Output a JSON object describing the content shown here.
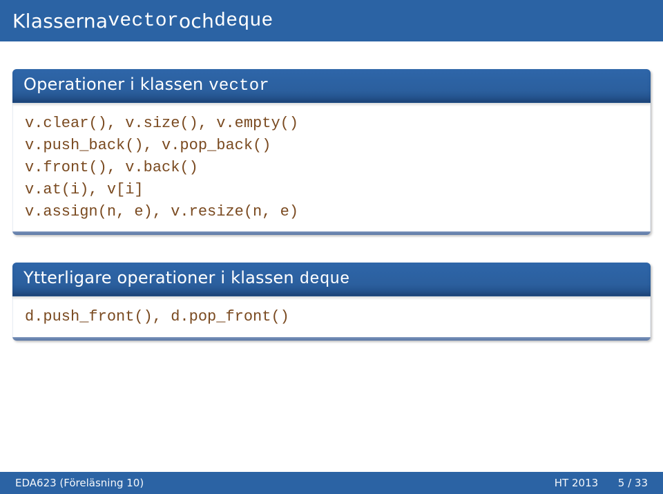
{
  "title": {
    "prefix": "Klasserna ",
    "code1": "vector",
    "mid": " och ",
    "code2": "deque"
  },
  "block1": {
    "header_prefix": "Operationer i klassen ",
    "header_code": "vector",
    "lines": [
      "v.clear(), v.size(), v.empty()",
      "v.push_back(), v.pop_back()",
      "v.front(), v.back()",
      "v.at(i), v[i]",
      "v.assign(n, e), v.resize(n, e)"
    ]
  },
  "block2": {
    "header_prefix": "Ytterligare operationer i klassen ",
    "header_code": "deque",
    "lines": [
      "d.push_front(), d.pop_front()"
    ]
  },
  "footer": {
    "left": "EDA623 (Föreläsning 10)",
    "right_term": "HT 2013",
    "right_page": "5 / 33"
  }
}
